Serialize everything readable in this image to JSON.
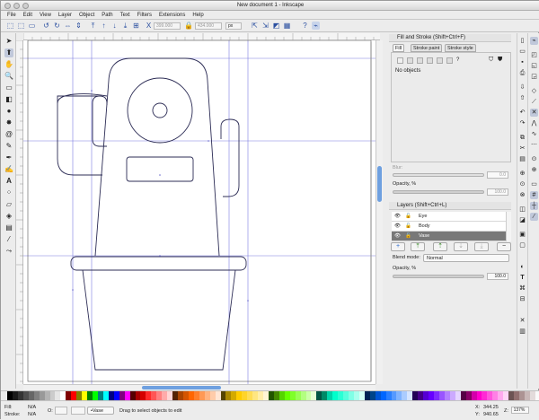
{
  "window": {
    "title": "New document 1 - Inkscape"
  },
  "menubar": [
    "File",
    "Edit",
    "View",
    "Layer",
    "Object",
    "Path",
    "Text",
    "Filters",
    "Extensions",
    "Help"
  ],
  "toolbar": {
    "x_field": "399.000",
    "y_field": "434.000",
    "unit": "px",
    "x_label": "X",
    "y_label": "Y"
  },
  "fill_stroke": {
    "title": "Fill and Stroke (Shift+Ctrl+F)",
    "tabs": [
      "Fill",
      "Stroke paint",
      "Stroke style"
    ],
    "no_objects": "No objects",
    "blur_label": "Blur:",
    "blur_value": "0.0",
    "opacity_label": "Opacity, %",
    "opacity_value": "100.0",
    "paint_mode_glyph": "?"
  },
  "layers": {
    "title": "Layers (Shift+Ctrl+L)",
    "rows": [
      {
        "name": "Eye"
      },
      {
        "name": "Body"
      },
      {
        "name": "Vase"
      }
    ],
    "selected_index": 2,
    "blend_label": "Blend mode:",
    "blend_value": "Normal",
    "opacity_label": "Opacity, %",
    "opacity_value": "100.0",
    "buttons": [
      "+",
      "⤒",
      "⇡",
      "⇣",
      "⤓",
      "−"
    ]
  },
  "status": {
    "fill_label": "Fill:",
    "fill_value": "N/A",
    "stroke_label": "Stroke:",
    "stroke_value": "N/A",
    "o_label": "O:",
    "layer_value": "•Vase",
    "message": "Drag to select objects to edit",
    "x_label": "X:",
    "x_value": "344.25",
    "y_label": "Y:",
    "y_value": "940.65",
    "z_label": "Z:",
    "zoom": "137%"
  },
  "palette_colors": [
    "#000000",
    "#1a1a1a",
    "#333333",
    "#4d4d4d",
    "#666666",
    "#808080",
    "#999999",
    "#b3b3b3",
    "#cccccc",
    "#e6e6e6",
    "#ffffff",
    "#800000",
    "#ff0000",
    "#808000",
    "#ffff00",
    "#008000",
    "#00ff00",
    "#008080",
    "#00ffff",
    "#000080",
    "#0000ff",
    "#800080",
    "#ff00ff",
    "#550000",
    "#aa0000",
    "#d40000",
    "#ff2a2a",
    "#ff5555",
    "#ff8080",
    "#ffaaaa",
    "#ffd5d5",
    "#552200",
    "#aa4400",
    "#d45500",
    "#ff6600",
    "#ff7f2a",
    "#ff9955",
    "#ffb380",
    "#ffccaa",
    "#ffe6d5",
    "#554400",
    "#aa8800",
    "#d4aa00",
    "#ffcc00",
    "#ffd42a",
    "#ffdd55",
    "#ffe680",
    "#ffeeaa",
    "#fff6d5",
    "#225500",
    "#448800",
    "#55d400",
    "#66ff00",
    "#7fff2a",
    "#99ff55",
    "#b3ff80",
    "#ccffaa",
    "#e5ffd5",
    "#005544",
    "#008866",
    "#00d4aa",
    "#00ffcc",
    "#2affd5",
    "#55ffdd",
    "#80ffe6",
    "#aaffee",
    "#d5fff6",
    "#002255",
    "#004488",
    "#0055d4",
    "#0066ff",
    "#2a7fff",
    "#5599ff",
    "#80b3ff",
    "#aaccff",
    "#d5e5ff",
    "#220055",
    "#440088",
    "#5500d4",
    "#6600ff",
    "#7f2aff",
    "#9955ff",
    "#b380ff",
    "#ccaaff",
    "#e5d5ff",
    "#550044",
    "#880066",
    "#d400aa",
    "#ff00cc",
    "#ff2ad4",
    "#ff55dd",
    "#ff80e5",
    "#ffaaee",
    "#ffd5f6",
    "#6c5353",
    "#916f6f",
    "#ac9393",
    "#c8b7b7",
    "#e3dbdb",
    "#f9f9f9"
  ]
}
